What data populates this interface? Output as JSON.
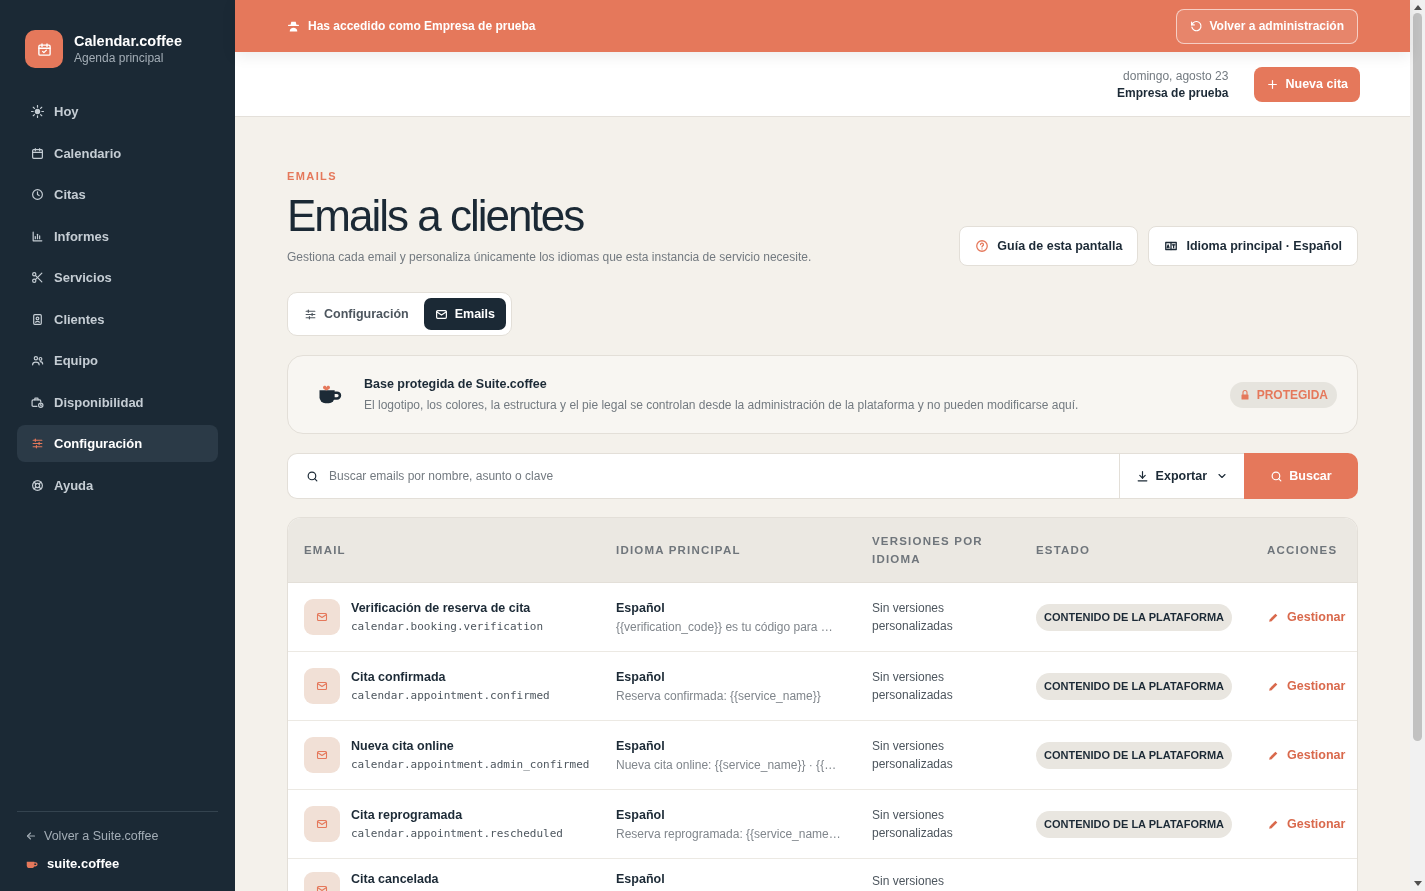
{
  "sidebar": {
    "brand": {
      "title": "Calendar.coffee",
      "subtitle": "Agenda principal"
    },
    "items": [
      {
        "label": "Hoy",
        "selected": false
      },
      {
        "label": "Calendario",
        "selected": false
      },
      {
        "label": "Citas",
        "selected": false
      },
      {
        "label": "Informes",
        "selected": false
      },
      {
        "label": "Servicios",
        "selected": false
      },
      {
        "label": "Clientes",
        "selected": false
      },
      {
        "label": "Equipo",
        "selected": false
      },
      {
        "label": "Disponibilidad",
        "selected": false
      },
      {
        "label": "Configuración",
        "selected": true
      },
      {
        "label": "Ayuda",
        "selected": false
      }
    ],
    "back_link": "Volver a Suite.coffee",
    "footer_brand": "suite.coffee"
  },
  "banner": {
    "text": "Has accedido como Empresa de prueba",
    "button": "Volver a administración"
  },
  "header": {
    "date": "domingo, agosto 23",
    "company": "Empresa de prueba",
    "button": "Nueva cita"
  },
  "page": {
    "eyebrow": "EMAILS",
    "title": "Emails a clientes",
    "subtitle": "Gestiona cada email y personaliza únicamente los idiomas que esta instancia de servicio necesite.",
    "actions": [
      "Guía de esta pantalla",
      "Idioma principal · Español"
    ]
  },
  "tabs": [
    {
      "label": "Configuración",
      "selected": false
    },
    {
      "label": "Emails",
      "selected": true
    }
  ],
  "notice": {
    "title": "Base protegida de Suite.coffee",
    "text": "El logotipo, los colores, la estructura y el pie legal se controlan desde la administración de la plataforma y no pueden modificarse aquí.",
    "badge": "PROTEGIDA"
  },
  "search": {
    "placeholder": "Buscar emails por nombre, asunto o clave",
    "export": "Exportar",
    "button": "Buscar"
  },
  "table": {
    "columns": [
      "EMAIL",
      "IDIOMA PRINCIPAL",
      "VERSIONES POR IDIOMA",
      "ESTADO",
      "ACCIONES"
    ],
    "rows": [
      {
        "name": "Verificación de reserva de cita",
        "key": "calendar.booking.verification",
        "language": "Español",
        "preview": "{{verification_code}} es tu código para …",
        "versions": "Sin versiones personalizadas",
        "status": "CONTENIDO DE LA PLATAFORMA",
        "action": "Gestionar"
      },
      {
        "name": "Cita confirmada",
        "key": "calendar.appointment.confirmed",
        "language": "Español",
        "preview": "Reserva confirmada: {{service_name}}",
        "versions": "Sin versiones personalizadas",
        "status": "CONTENIDO DE LA PLATAFORMA",
        "action": "Gestionar"
      },
      {
        "name": "Nueva cita online",
        "key": "calendar.appointment.admin_confirmed",
        "language": "Español",
        "preview": "Nueva cita online: {{service_name}} · {{…",
        "versions": "Sin versiones personalizadas",
        "status": "CONTENIDO DE LA PLATAFORMA",
        "action": "Gestionar"
      },
      {
        "name": "Cita reprogramada",
        "key": "calendar.appointment.rescheduled",
        "language": "Español",
        "preview": "Reserva reprogramada: {{service_name…",
        "versions": "Sin versiones personalizadas",
        "status": "CONTENIDO DE LA PLATAFORMA",
        "action": "Gestionar"
      },
      {
        "name": "Cita cancelada",
        "language": "Español",
        "versions": "Sin versiones"
      }
    ]
  }
}
